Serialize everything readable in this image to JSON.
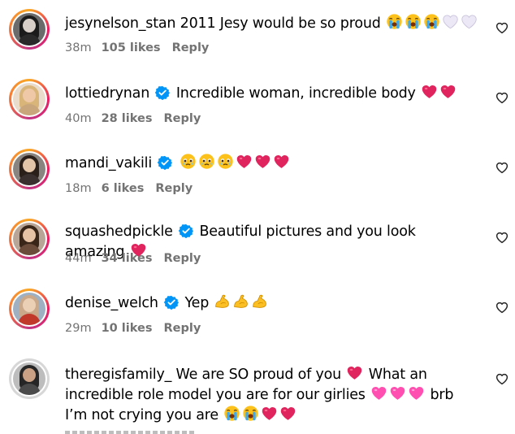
{
  "comments": [
    {
      "username": "jesynelson_stan",
      "verified": false,
      "text": "2011 Jesy would be so proud",
      "emoji": [
        "crying-face",
        "crying-face",
        "crying-face",
        "white-heart",
        "white-heart"
      ],
      "time": "38m",
      "likes": "105 likes",
      "reply": "Reply"
    },
    {
      "username": "lottiedrynan",
      "verified": true,
      "text": "Incredible woman, incredible body",
      "emoji": [
        "red-heart",
        "red-heart"
      ],
      "time": "40m",
      "likes": "28 likes",
      "reply": "Reply"
    },
    {
      "username": "mandi_vakili",
      "verified": true,
      "text": "",
      "emoji": [
        "teary-face",
        "teary-face",
        "teary-face",
        "red-heart",
        "red-heart",
        "red-heart"
      ],
      "time": "18m",
      "likes": "6 likes",
      "reply": "Reply"
    },
    {
      "username": "squashedpickle",
      "verified": true,
      "text": "Beautiful pictures and you look amazing",
      "emoji": [
        "red-heart"
      ],
      "time": "44m",
      "likes": "34 likes",
      "reply": "Reply"
    },
    {
      "username": "denise_welch",
      "verified": true,
      "text": "Yep",
      "emoji": [
        "flexed-biceps",
        "flexed-biceps",
        "flexed-biceps"
      ],
      "time": "29m",
      "likes": "10 likes",
      "reply": "Reply"
    },
    {
      "username": "theregisfamily_",
      "verified": false,
      "text_part1": "We are SO proud of you",
      "text_part2": "What an incredible role model you are for our girlies",
      "text_part3": "brb I’m not crying you are",
      "emoji1": [
        "red-heart"
      ],
      "emoji2": [
        "pink-heart",
        "pink-heart",
        "pink-heart"
      ],
      "emoji3": [
        "crying-face",
        "crying-face",
        "red-heart",
        "red-heart"
      ]
    }
  ],
  "icons": {
    "like": "heart-outline-icon",
    "verified": "verified-badge-icon"
  },
  "colors": {
    "verified": "#0095f6",
    "meta": "#737373",
    "heart": "#e0245e",
    "pink": "#ff5fb8"
  }
}
